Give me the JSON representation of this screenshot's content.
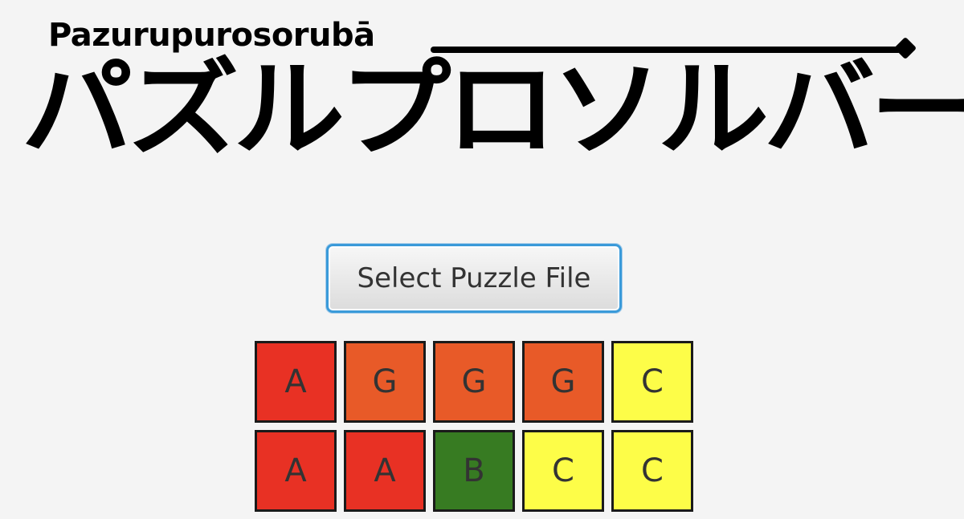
{
  "logo": {
    "subtitle": "Pazurupurosorubā",
    "title_chars": [
      "パ",
      "ズ",
      "ル",
      "プ",
      "ロ",
      "ソ",
      "ル",
      "バ",
      "ー"
    ]
  },
  "select_button_label": "Select Puzzle File",
  "colors": {
    "A": "#e83124",
    "G": "#e85a28",
    "B": "#377b22",
    "C": "#fdfd48",
    "background": "#f4f4f4",
    "button_focus": "#3a9ad9"
  },
  "grid": {
    "rows": [
      [
        "A",
        "G",
        "G",
        "G",
        "C"
      ],
      [
        "A",
        "A",
        "B",
        "C",
        "C"
      ]
    ]
  }
}
